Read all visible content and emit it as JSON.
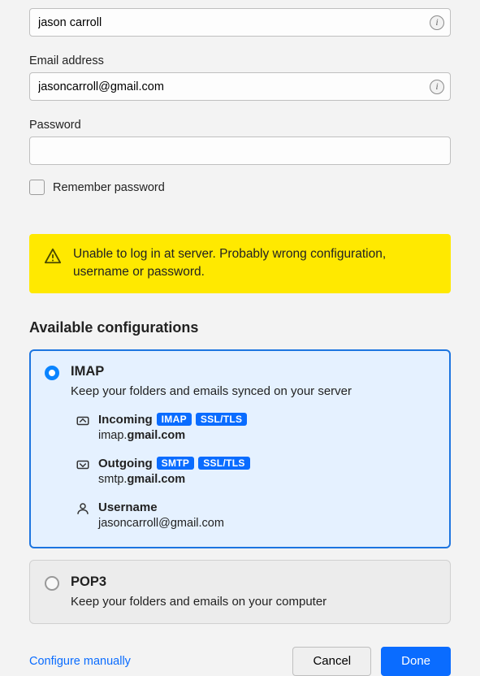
{
  "fields": {
    "name_value": "jason carroll",
    "email_label": "Email address",
    "email_value": "jasoncarroll@gmail.com",
    "password_label": "Password",
    "password_value": "",
    "remember_label": "Remember password"
  },
  "alert": {
    "message": "Unable to log in at server. Probably wrong configuration, username or password."
  },
  "configs": {
    "title": "Available configurations",
    "imap": {
      "title": "IMAP",
      "desc": "Keep your folders and emails synced on your server",
      "incoming_label": "Incoming",
      "incoming_badge_proto": "IMAP",
      "incoming_badge_sec": "SSL/TLS",
      "incoming_host_prefix": "imap.",
      "incoming_host_bold": "gmail.com",
      "outgoing_label": "Outgoing",
      "outgoing_badge_proto": "SMTP",
      "outgoing_badge_sec": "SSL/TLS",
      "outgoing_host_prefix": "smtp.",
      "outgoing_host_bold": "gmail.com",
      "username_label": "Username",
      "username_value": "jasoncarroll@gmail.com"
    },
    "pop3": {
      "title": "POP3",
      "desc": "Keep your folders and emails on your computer"
    }
  },
  "footer": {
    "manual": "Configure manually",
    "cancel": "Cancel",
    "done": "Done"
  }
}
